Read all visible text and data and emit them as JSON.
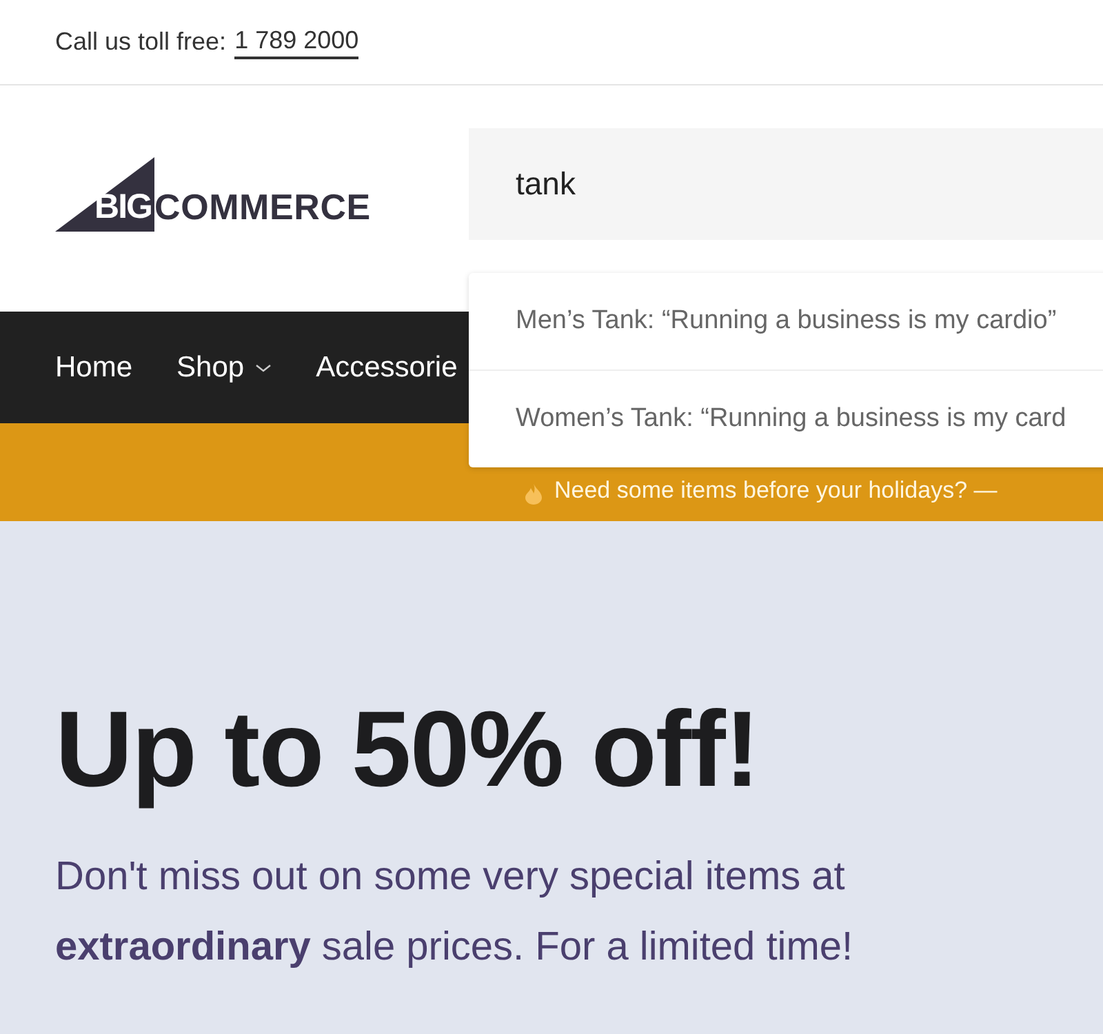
{
  "top_bar": {
    "label": "Call us toll free:",
    "phone": "1 789 2000"
  },
  "logo": {
    "mark_text": "BIG",
    "word": "COMMERCE"
  },
  "search": {
    "value": "tank"
  },
  "suggestions": [
    {
      "text": "Men’s Tank: “Running a business is my cardio”"
    },
    {
      "text": "Women’s Tank: “Running a business is my card"
    }
  ],
  "nav": [
    {
      "label": "Home",
      "has_menu": false
    },
    {
      "label": "Shop",
      "has_menu": true
    },
    {
      "label": "Accessorie",
      "has_menu": false
    }
  ],
  "banner": {
    "text": "Need some items before your holidays? —"
  },
  "hero": {
    "heading": "Up to 50% off!",
    "text": "Don't miss out on some very special items at **extraordinary** sale prices. For a limited time!"
  }
}
